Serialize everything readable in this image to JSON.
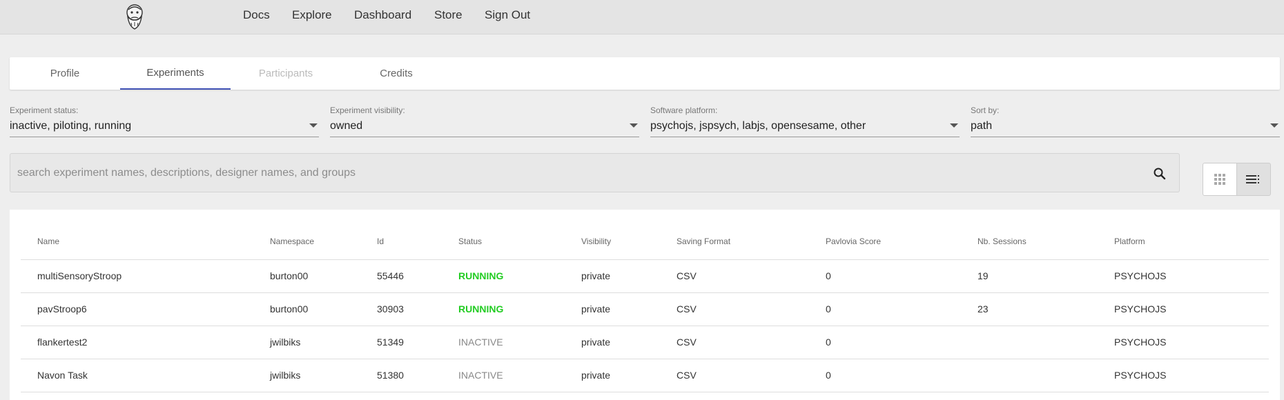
{
  "nav": {
    "links": [
      "Docs",
      "Explore",
      "Dashboard",
      "Store",
      "Sign Out"
    ]
  },
  "tabs": [
    {
      "label": "Profile",
      "state": "normal"
    },
    {
      "label": "Experiments",
      "state": "active"
    },
    {
      "label": "Participants",
      "state": "disabled"
    },
    {
      "label": "Credits",
      "state": "normal"
    }
  ],
  "filters": {
    "status": {
      "label": "Experiment status:",
      "value": "inactive, piloting, running"
    },
    "visibility": {
      "label": "Experiment visibility:",
      "value": "owned"
    },
    "platform": {
      "label": "Software platform:",
      "value": "psychojs, jspsych, labjs, opensesame, other"
    },
    "sort": {
      "label": "Sort by:",
      "value": "path"
    }
  },
  "search": {
    "placeholder": "search experiment names, descriptions, designer names, and groups",
    "value": ""
  },
  "table": {
    "headers": [
      "Name",
      "Namespace",
      "Id",
      "Status",
      "Visibility",
      "Saving Format",
      "Pavlovia Score",
      "Nb. Sessions",
      "Platform"
    ],
    "rows": [
      [
        "multiSensoryStroop",
        "burton00",
        "55446",
        "RUNNING",
        "private",
        "CSV",
        "0",
        "19",
        "PSYCHOJS"
      ],
      [
        "pavStroop6",
        "burton00",
        "30903",
        "RUNNING",
        "private",
        "CSV",
        "0",
        "23",
        "PSYCHOJS"
      ],
      [
        "flankertest2",
        "jwilbiks",
        "51349",
        "INACTIVE",
        "private",
        "CSV",
        "0",
        "",
        "PSYCHOJS"
      ],
      [
        "Navon Task",
        "jwilbiks",
        "51380",
        "INACTIVE",
        "private",
        "CSV",
        "0",
        "",
        "PSYCHOJS"
      ]
    ]
  },
  "colors": {
    "accent": "#3f51b5",
    "running": "#22cc22",
    "inactive": "#888888"
  }
}
